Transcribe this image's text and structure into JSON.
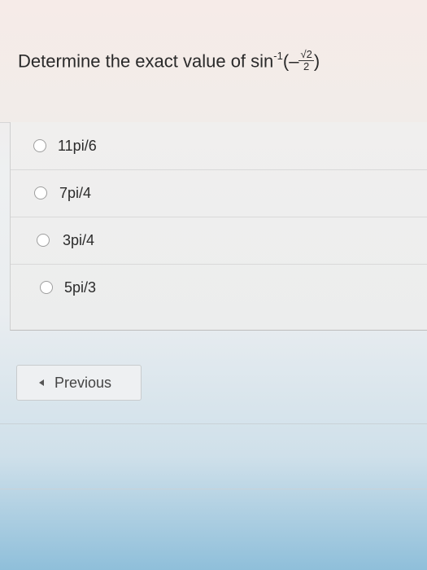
{
  "question": {
    "prefix": "Determine the exact value of",
    "func": "sin",
    "exponent": "-1",
    "open": "(",
    "minus": "–",
    "numerator": "√2",
    "denominator": "2",
    "close": ")"
  },
  "options": [
    {
      "label": "11pi/6"
    },
    {
      "label": "7pi/4"
    },
    {
      "label": "3pi/4"
    },
    {
      "label": "5pi/3"
    }
  ],
  "navigation": {
    "previous_label": "Previous",
    "previous_icon": "chevron-left-icon"
  }
}
